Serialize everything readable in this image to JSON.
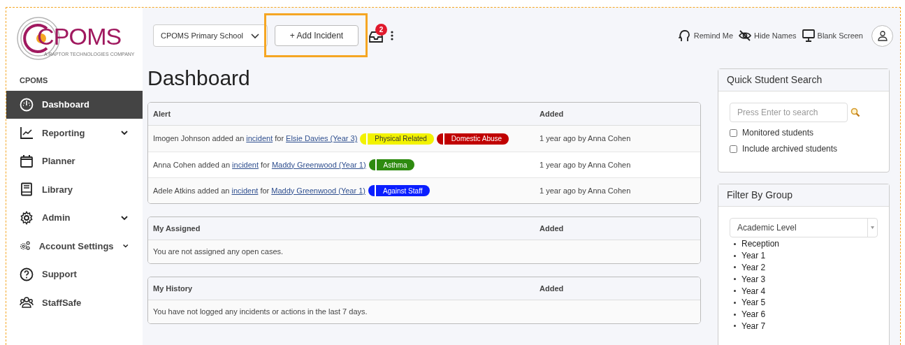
{
  "logo": {
    "name": "CPOMS",
    "tagline": "A RAPTOR TECHNOLOGIES COMPANY"
  },
  "topbar": {
    "school": "CPOMS Primary School",
    "add_button": {
      "label": "+ Add Incident",
      "highlighted": true
    },
    "inbox_count": "2",
    "actions": [
      {
        "kind": "remind",
        "label": "Remind Me"
      },
      {
        "kind": "hide",
        "label": "Hide Names"
      },
      {
        "kind": "blank",
        "label": "Blank Screen"
      }
    ]
  },
  "sidebar": {
    "heading": "CPOMS",
    "items": [
      {
        "kind": "dashboard",
        "label": "Dashboard",
        "selected": true,
        "expandable": false
      },
      {
        "kind": "reporting",
        "label": "Reporting",
        "selected": false,
        "expandable": true
      },
      {
        "kind": "planner",
        "label": "Planner",
        "selected": false,
        "expandable": false
      },
      {
        "kind": "library",
        "label": "Library",
        "selected": false,
        "expandable": false
      },
      {
        "kind": "admin",
        "label": "Admin",
        "selected": false,
        "expandable": true
      },
      {
        "kind": "account",
        "label": "Account Settings",
        "selected": false,
        "expandable": true
      },
      {
        "kind": "support",
        "label": "Support",
        "selected": false,
        "expandable": false
      },
      {
        "kind": "staffsafe",
        "label": "StaffSafe",
        "selected": false,
        "expandable": false
      }
    ]
  },
  "page_title": "Dashboard",
  "alerts": {
    "columns": [
      "Alert",
      "Added"
    ],
    "rows": [
      {
        "parts": [
          {
            "kind": "text",
            "text": "Imogen Johnson added an"
          },
          {
            "kind": "link",
            "text": "incident"
          },
          {
            "kind": "text",
            "text": "for"
          },
          {
            "kind": "link",
            "text": "Elsie Davies (Year 3)"
          }
        ],
        "tags": [
          {
            "label": "Physical Related",
            "color": "#f2f200"
          },
          {
            "label": "Domestic Abuse",
            "color": "#c00000"
          }
        ],
        "added": "1 year ago by Anna Cohen"
      },
      {
        "parts": [
          {
            "kind": "text",
            "text": "Anna Cohen added an"
          },
          {
            "kind": "link",
            "text": "incident"
          },
          {
            "kind": "text",
            "text": "for"
          },
          {
            "kind": "link",
            "text": "Maddy Greenwood (Year 1)"
          }
        ],
        "tags": [
          {
            "label": "Asthma",
            "color": "#2e8b10"
          }
        ],
        "added": "1 year ago by Anna Cohen"
      },
      {
        "parts": [
          {
            "kind": "text",
            "text": "Adele Atkins added an"
          },
          {
            "kind": "link",
            "text": "incident"
          },
          {
            "kind": "text",
            "text": "for"
          },
          {
            "kind": "link",
            "text": "Maddy Greenwood (Year 1)"
          }
        ],
        "tags": [
          {
            "label": "Against Staff",
            "color": "#0a1eff"
          }
        ],
        "added": "1 year ago by Anna Cohen"
      }
    ]
  },
  "assigned": {
    "columns": [
      "My Assigned",
      "Added"
    ],
    "message": "You are not assigned any open cases."
  },
  "history": {
    "columns": [
      "My History",
      "Added"
    ],
    "message": "You have not logged any incidents or actions in the last 7 days."
  },
  "quick_search": {
    "title": "Quick Student Search",
    "placeholder": "Press Enter to search",
    "options": [
      {
        "label": "Monitored students",
        "checked": false
      },
      {
        "label": "Include archived students",
        "checked": false
      }
    ]
  },
  "filter": {
    "title": "Filter By Group",
    "select": "Academic Level",
    "groups": [
      "Reception",
      "Year 1",
      "Year 2",
      "Year 3",
      "Year 4",
      "Year 5",
      "Year 6",
      "Year 7"
    ]
  }
}
